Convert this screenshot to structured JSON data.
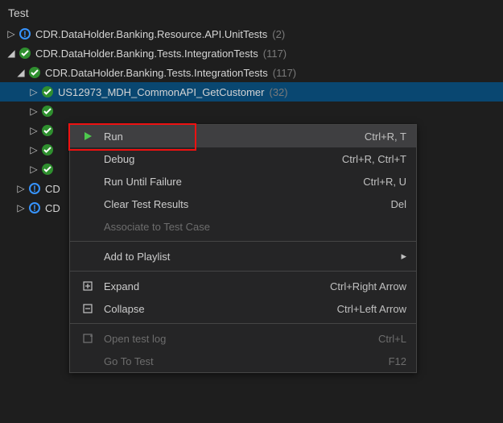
{
  "title": "Test",
  "tree": [
    {
      "name": "CDR.DataHolder.Banking.Resource.API.UnitTests",
      "count": "(2)"
    },
    {
      "name": "CDR.DataHolder.Banking.Tests.IntegrationTests",
      "count": "(117)"
    },
    {
      "name": "CDR.DataHolder.Banking.Tests.IntegrationTests",
      "count": "(117)"
    },
    {
      "name": "US12973_MDH_CommonAPI_GetCustomer",
      "count": "(32)"
    }
  ],
  "truncated": "CD",
  "menu": {
    "run": {
      "label": "Run",
      "shortcut": "Ctrl+R, T"
    },
    "debug": {
      "label": "Debug",
      "shortcut": "Ctrl+R, Ctrl+T"
    },
    "runfail": {
      "label": "Run Until Failure",
      "shortcut": "Ctrl+R, U"
    },
    "clear": {
      "label": "Clear Test Results",
      "shortcut": "Del"
    },
    "assoc": {
      "label": "Associate to Test Case"
    },
    "playlist": {
      "label": "Add to Playlist",
      "sub": "▸"
    },
    "expand": {
      "label": "Expand",
      "shortcut": "Ctrl+Right Arrow"
    },
    "collapse": {
      "label": "Collapse",
      "shortcut": "Ctrl+Left Arrow"
    },
    "openlog": {
      "label": "Open test log",
      "shortcut": "Ctrl+L"
    },
    "goto": {
      "label": "Go To Test",
      "shortcut": "F12"
    }
  }
}
